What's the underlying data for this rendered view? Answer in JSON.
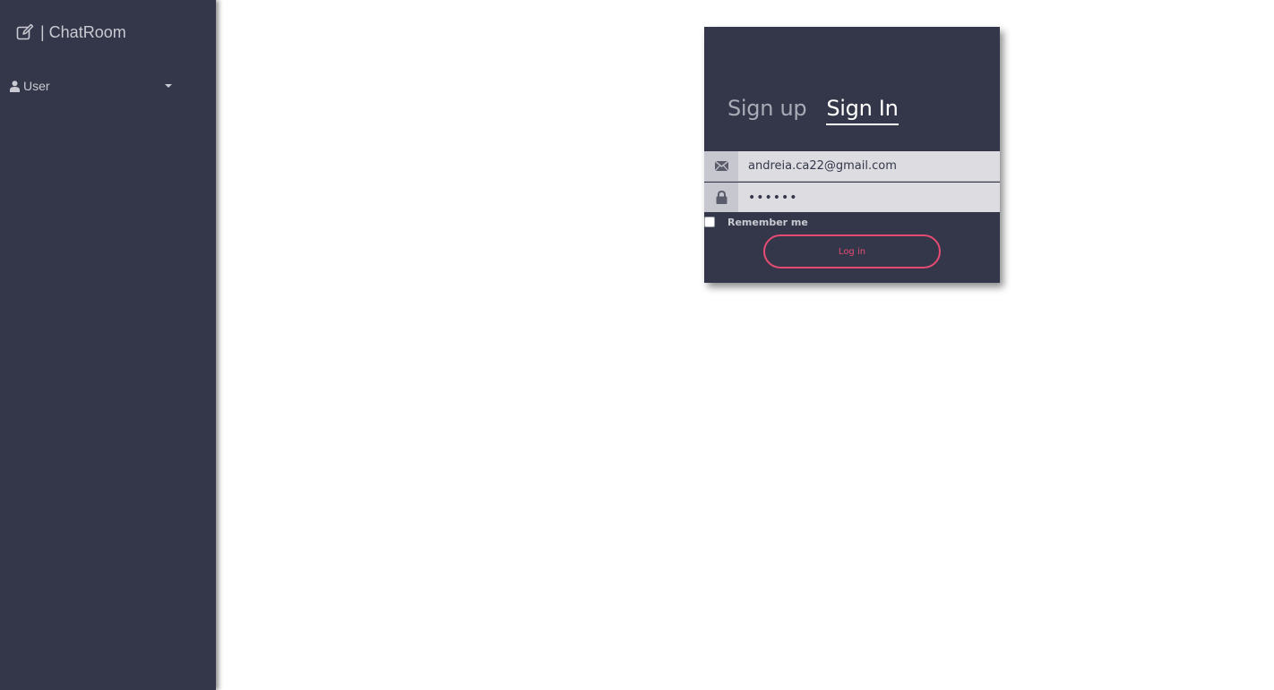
{
  "sidebar": {
    "brand": "| ChatRoom",
    "brand_icon": "edit-icon",
    "user_menu": {
      "label": "User",
      "icon": "user-icon"
    }
  },
  "login_card": {
    "tabs": [
      {
        "label": "Sign up",
        "active": false
      },
      {
        "label": "Sign In",
        "active": true
      }
    ],
    "email": {
      "icon": "envelope-icon",
      "value": "andreia.ca22@gmail.com"
    },
    "password": {
      "icon": "lock-icon",
      "value": "••••••"
    },
    "remember_label": "Remember me",
    "login_button": "Log in"
  },
  "colors": {
    "sidebar_bg": "#34374a",
    "card_bg": "#34374a",
    "accent": "#e74a73",
    "input_bg": "#dcdce1"
  }
}
